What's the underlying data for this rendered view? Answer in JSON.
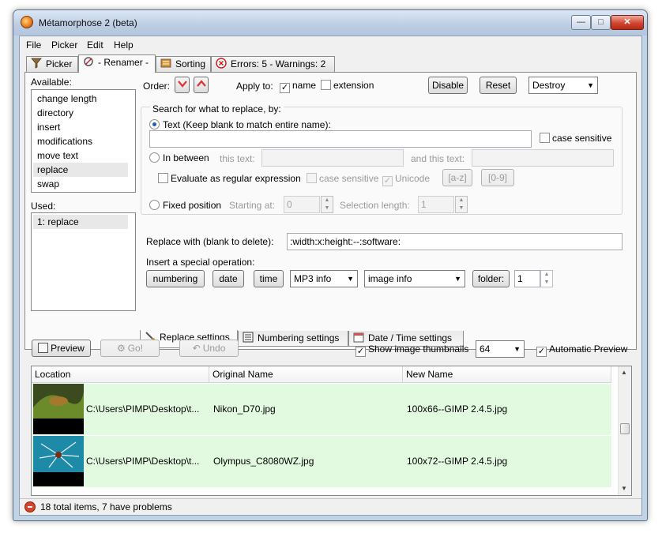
{
  "window": {
    "title": "Métamorphose 2 (beta)",
    "min": "—",
    "max": "□",
    "close": "✕"
  },
  "menu": [
    "File",
    "Picker",
    "Edit",
    "Help"
  ],
  "tabs": [
    {
      "label": "Picker",
      "icon": "funnel-icon"
    },
    {
      "label": "- Renamer -",
      "icon": "renamer-icon"
    },
    {
      "label": "Sorting",
      "icon": "sorting-icon"
    },
    {
      "label": "Errors: 5 - Warnings: 2",
      "icon": "error-icon"
    }
  ],
  "renamer": {
    "available_label": "Available:",
    "available": [
      "change length",
      "directory",
      "insert",
      "modifications",
      "move text",
      "replace",
      "swap"
    ],
    "available_selected": "replace",
    "used_label": "Used:",
    "used": [
      "1: replace"
    ],
    "order_label": "Order:",
    "apply_to_label": "Apply to:",
    "apply_name": "name",
    "apply_extension": "extension",
    "disable_label": "Disable",
    "reset_label": "Reset",
    "destroy_label": "Destroy",
    "search_group_label": "Search for what to replace, by:",
    "text_option": "Text (Keep blank to match entire name):",
    "text_value": "",
    "case_sensitive": "case sensitive",
    "in_between": "In between",
    "this_text": "this text:",
    "and_this_text": "and this text:",
    "regex_label": "Evaluate as regular expression",
    "regex_case": "case sensitive",
    "unicode": "Unicode",
    "az_button": "[a-z]",
    "digits_button": "[0-9]",
    "fixed_position": "Fixed position",
    "starting_at": "Starting at:",
    "starting_value": "0",
    "selection_length": "Selection length:",
    "selection_value": "1",
    "replace_with_label": "Replace with (blank to delete):",
    "replace_with_value": ":width:x:height:--:software:",
    "special_label": "Insert a special operation:",
    "special_buttons": [
      "numbering",
      "date",
      "time"
    ],
    "mp3_select": "MP3 info",
    "image_select": "image info",
    "folder_button": "folder:",
    "folder_value": "1",
    "subtabs": [
      "Replace settings",
      "Numbering settings",
      "Date / Time settings"
    ]
  },
  "actions": {
    "preview": "Preview",
    "go": "Go!",
    "undo": "Undo",
    "show_thumbnails": "Show image thumbnails",
    "thumb_size": "64",
    "auto_preview": "Automatic Preview"
  },
  "table": {
    "headers": [
      "Location",
      "Original Name",
      "New Name"
    ],
    "rows": [
      {
        "location": "C:\\Users\\PIMP\\Desktop\\t...",
        "original": "Nikon_D70.jpg",
        "new": "100x66--GIMP 2.4.5.jpg"
      },
      {
        "location": "C:\\Users\\PIMP\\Desktop\\t...",
        "original": "Olympus_C8080WZ.jpg",
        "new": "100x72--GIMP 2.4.5.jpg"
      }
    ]
  },
  "status": {
    "text": "18 total items, 7 have problems"
  },
  "colors": {
    "row_ok": "#e2fbe0",
    "title_gradient": "#bccde3",
    "close": "#d2452f",
    "error": "#d9432c"
  }
}
